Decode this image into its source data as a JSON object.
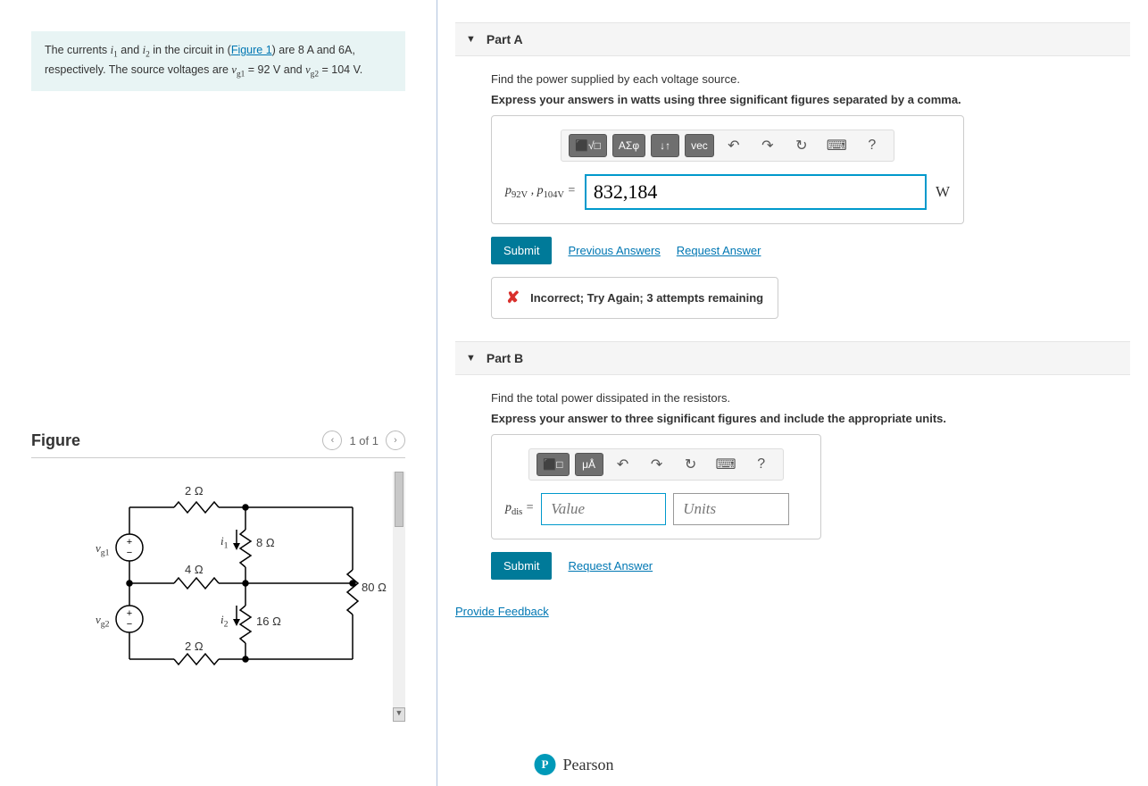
{
  "problem": {
    "text_pre": "The currents ",
    "i1": "i₁",
    "text_and": " and ",
    "i2": "i₂",
    "text_mid1": " in the circuit in (",
    "figure_link": "Figure 1",
    "text_mid2": ") are 8 ",
    "unit_a1": "A",
    "text_mid3": " and 6",
    "unit_a2": "A",
    "text_mid4": ", respectively. The source voltages are ",
    "vg1": "v_g1",
    "eq1": " = 92 ",
    "unit_v1": "V",
    "text_mid5": " and ",
    "vg2": "v_g2",
    "eq2": " = 104 ",
    "unit_v2": "V",
    "text_end": "."
  },
  "figure": {
    "title": "Figure",
    "pager": "1 of 1",
    "labels": {
      "r_top": "2 Ω",
      "r_left": "8 Ω",
      "r_mid": "4 Ω",
      "r_right": "80 Ω",
      "r_bot_mid": "16 Ω",
      "r_bot": "2 Ω",
      "vg1": "v_g1",
      "vg2": "v_g2",
      "i1": "i₁",
      "i2": "i₂"
    }
  },
  "partA": {
    "title": "Part A",
    "prompt": "Find the power supplied by each voltage source.",
    "instruction": "Express your answers in watts using three significant figures separated by a comma.",
    "toolbar": {
      "templates": "⬛√□",
      "greek": "ΑΣφ",
      "subscript": "↓↑",
      "vector": "vec",
      "undo": "↶",
      "redo": "↷",
      "reset": "↻",
      "keyboard": "⌨",
      "help": "?"
    },
    "var_label": "p92V , p104V =",
    "value": "832,184",
    "unit": "W",
    "submit": "Submit",
    "prev_answers": "Previous Answers",
    "request_answer": "Request Answer",
    "feedback": "Incorrect; Try Again; 3 attempts remaining"
  },
  "partB": {
    "title": "Part B",
    "prompt": "Find the total power dissipated in the resistors.",
    "instruction": "Express your answer to three significant figures and include the appropriate units.",
    "toolbar": {
      "templates": "⬛□",
      "units_tool": "μÅ",
      "undo": "↶",
      "redo": "↷",
      "reset": "↻",
      "keyboard": "⌨",
      "help": "?"
    },
    "var_label": "pdis =",
    "value_placeholder": "Value",
    "units_placeholder": "Units",
    "submit": "Submit",
    "request_answer": "Request Answer"
  },
  "provide_feedback": "Provide Feedback",
  "brand": "Pearson"
}
